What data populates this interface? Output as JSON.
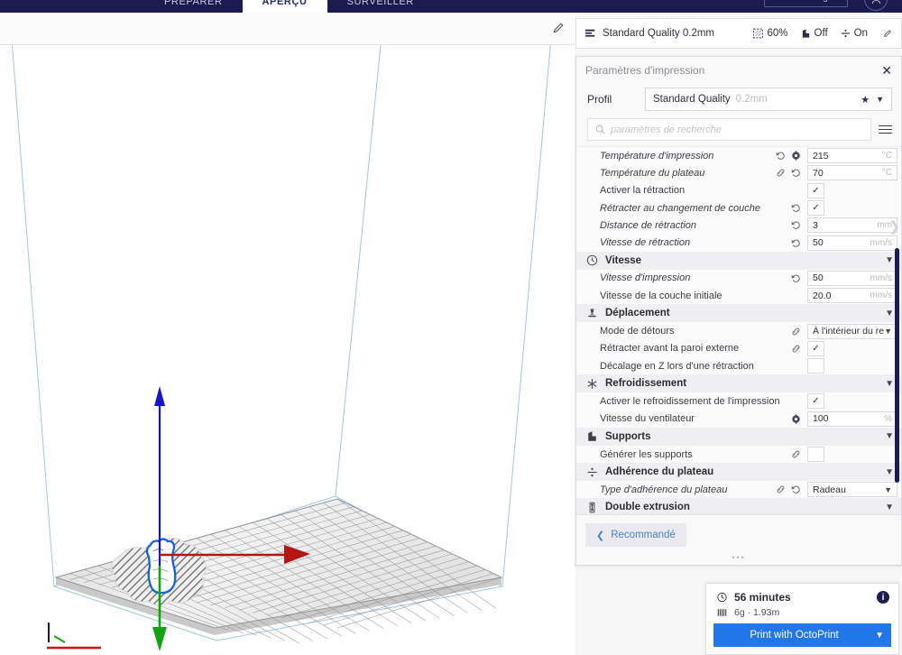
{
  "app": {
    "tabs": [
      {
        "label": "PRÉPARER",
        "active": false
      },
      {
        "label": "APERÇU",
        "active": true
      },
      {
        "label": "SURVEILLER",
        "active": false
      }
    ],
    "marketplace_label": "Marché en ligne",
    "account_icon": "user-icon"
  },
  "viewport": {
    "edit_icon": "pencil-icon"
  },
  "summary_bar": {
    "profile_icon": "layers-icon",
    "profile_label": "Standard Quality 0.2mm",
    "infill": {
      "icon": "infill-icon",
      "value": "60%"
    },
    "support": {
      "icon": "support-icon",
      "value": "Off"
    },
    "adhesion": {
      "icon": "adhesion-icon",
      "value": "On"
    },
    "edit_icon": "pencil-icon"
  },
  "settings_panel": {
    "title": "Paramètres d'impression",
    "close_icon": "close-icon",
    "profile": {
      "label": "Profil",
      "value": "Standard Quality",
      "suffix": "0.2mm",
      "star_icon": "star-icon",
      "chevron_icon": "chevron-down-icon"
    },
    "search": {
      "icon": "search-icon",
      "placeholder": "paramètres de recherche",
      "value": "",
      "menu_icon": "hamburger-icon"
    },
    "rows": [
      {
        "kind": "setting",
        "label": "Température d'impression",
        "italic": true,
        "icons": [
          "revert-icon",
          "link-gear-icon"
        ],
        "control": "text",
        "value": "215",
        "unit": "°C"
      },
      {
        "kind": "setting",
        "label": "Température du plateau",
        "italic": true,
        "icons": [
          "link-icon",
          "revert-icon"
        ],
        "control": "text",
        "value": "70",
        "unit": "°C"
      },
      {
        "kind": "setting",
        "label": "Activer la rétraction",
        "italic": false,
        "icons": [],
        "control": "check",
        "checked": true
      },
      {
        "kind": "setting",
        "label": "Rétracter au changement de couche",
        "italic": true,
        "icons": [
          "revert-icon"
        ],
        "control": "check",
        "checked": true
      },
      {
        "kind": "setting",
        "label": "Distance de rétraction",
        "italic": true,
        "icons": [
          "revert-icon"
        ],
        "control": "text",
        "value": "3",
        "unit": "mm"
      },
      {
        "kind": "setting",
        "label": "Vitesse de rétraction",
        "italic": true,
        "icons": [
          "revert-icon"
        ],
        "control": "text",
        "value": "50",
        "unit": "mm/s"
      },
      {
        "kind": "section",
        "label": "Vitesse",
        "icon": "speed-clock-icon",
        "chevron": "chevron-down-icon"
      },
      {
        "kind": "setting",
        "label": "Vitesse d'impression",
        "italic": true,
        "icons": [
          "revert-icon"
        ],
        "control": "text",
        "value": "50",
        "unit": "mm/s"
      },
      {
        "kind": "setting",
        "label": "Vitesse de la couche initiale",
        "italic": false,
        "icons": [],
        "control": "text",
        "value": "20.0",
        "unit": "mm/s"
      },
      {
        "kind": "section",
        "label": "Déplacement",
        "icon": "travel-icon",
        "chevron": "chevron-down-icon"
      },
      {
        "kind": "setting",
        "label": "Mode de détours",
        "italic": false,
        "icons": [
          "link-icon"
        ],
        "control": "select",
        "value": "À l'intérieur du re..."
      },
      {
        "kind": "setting",
        "label": "Rétracter avant la paroi externe",
        "italic": false,
        "icons": [
          "link-icon"
        ],
        "control": "check",
        "checked": true
      },
      {
        "kind": "setting",
        "label": "Décalage en Z lors d'une rétraction",
        "italic": false,
        "icons": [],
        "control": "check",
        "checked": false
      },
      {
        "kind": "section",
        "label": "Refroidissement",
        "icon": "fan-icon",
        "chevron": "chevron-down-icon"
      },
      {
        "kind": "setting",
        "label": "Activer le refroidissement de l'impression",
        "italic": false,
        "icons": [],
        "control": "check",
        "checked": true
      },
      {
        "kind": "setting",
        "label": "Vitesse du ventilateur",
        "italic": false,
        "icons": [
          "link-gear-icon"
        ],
        "control": "text",
        "value": "100",
        "unit": "%"
      },
      {
        "kind": "section",
        "label": "Supports",
        "icon": "support-icon",
        "chevron": "chevron-down-icon"
      },
      {
        "kind": "setting",
        "label": "Générer les supports",
        "italic": false,
        "icons": [
          "link-icon"
        ],
        "control": "check",
        "checked": false
      },
      {
        "kind": "section",
        "label": "Adhérence du plateau",
        "icon": "adhesion-icon",
        "chevron": "chevron-down-icon"
      },
      {
        "kind": "setting",
        "label": "Type d'adhérence du plateau",
        "italic": true,
        "icons": [
          "link-icon",
          "revert-icon"
        ],
        "control": "select",
        "value": "Radeau"
      },
      {
        "kind": "section",
        "label": "Double extrusion",
        "icon": "dual-extrusion-icon",
        "chevron": "chevron-down-icon"
      }
    ],
    "footer": {
      "recommended_label": "Recommandé",
      "back_icon": "chevron-left-icon",
      "grip_icon": "grip-dots-icon"
    },
    "collapse_icon": "chevron-right-icon"
  },
  "print_card": {
    "time_icon": "clock-icon",
    "time": "56 minutes",
    "info_icon": "info-icon",
    "material_icon": "filament-icon",
    "material": "6g · 1.93m",
    "print_button_label": "Print with OctoPrint",
    "print_button_chevron": "chevron-down-icon",
    "accent_color": "#2277e8"
  },
  "colors": {
    "appbar": "#1b1b4f",
    "scrollbar": "#1c1c52",
    "link": "#4b7fcc",
    "axis_x": "#b81414",
    "axis_y": "#13a313",
    "axis_z": "#1414cc",
    "model_outline": "#1565d8",
    "buildplate_border": "#9ec7e8"
  }
}
